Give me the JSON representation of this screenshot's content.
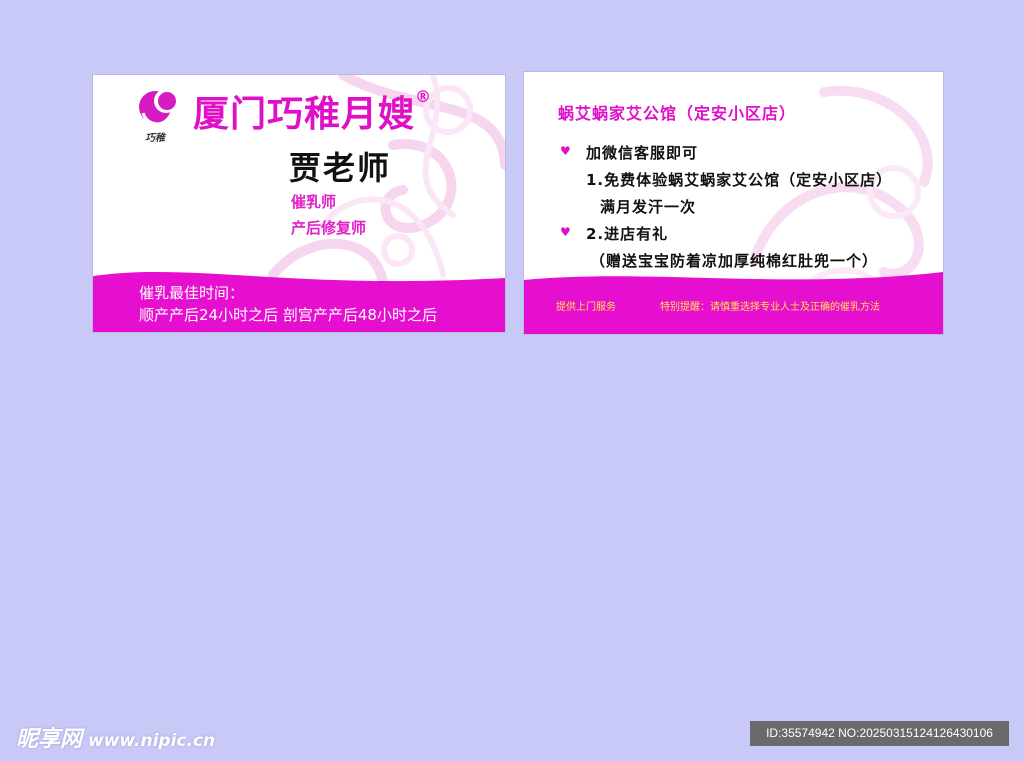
{
  "front_card": {
    "logo_caption": "巧稚",
    "brand_name": "厦门巧稚月嫂",
    "registered_mark": "®",
    "person_name": "贾老师",
    "titles": [
      "催乳师",
      "产后修复师"
    ],
    "bottom_lines": [
      "催乳最佳时间：",
      "顺产产后24小时之后    剖宫产产后48小时之后"
    ]
  },
  "back_card": {
    "heading": "蜗艾蜗家艾公馆（定安小区店）",
    "lines": [
      "加微信客服即可",
      "1.免费体验蜗艾蜗家艾公馆（定安小区店）",
      "满月发汗一次",
      "2.进店有礼",
      "（赠送宝宝防着凉加厚纯棉红肚兜一个）"
    ],
    "footer_left": "提供上门服务",
    "footer_right": "特别提醒：请慎重选择专业人士及正确的催乳方法"
  },
  "watermark": {
    "site": "昵享网",
    "url": "www.nipic.cn",
    "id_text": "ID:35574942 NO:20250315124126430106"
  },
  "colors": {
    "background": "#c9c9f7",
    "accent": "#e010c8",
    "band": "#e60fd0",
    "footer_text": "#ffe24a"
  }
}
